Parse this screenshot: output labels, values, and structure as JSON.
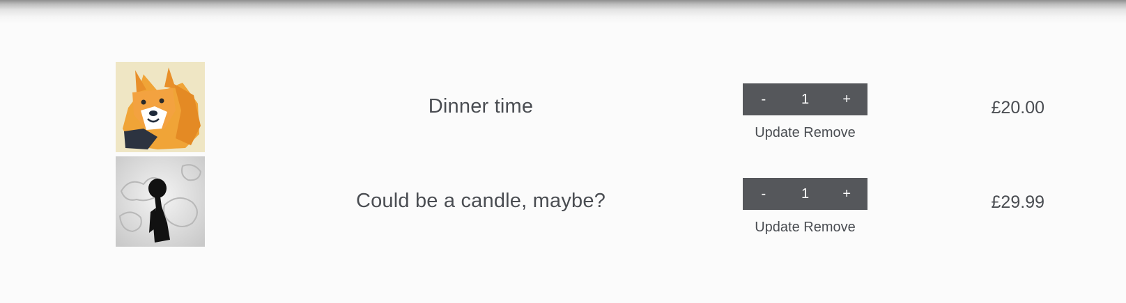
{
  "cart": {
    "items": [
      {
        "image_alt": "fox illustration",
        "title": "Dinner time",
        "quantity": {
          "decrement_label": "-",
          "value": "1",
          "increment_label": "+"
        },
        "update_label": "Update",
        "remove_label": "Remove",
        "price": "£20.00"
      },
      {
        "image_alt": "silhouette figure illustration",
        "title": "Could be a candle, maybe?",
        "quantity": {
          "decrement_label": "-",
          "value": "1",
          "increment_label": "+"
        },
        "update_label": "Update",
        "remove_label": "Remove",
        "price": "£29.99"
      }
    ]
  },
  "colors": {
    "background": "#fbfbfb",
    "text": "#4a4d52",
    "quantity_box": "#55575b",
    "quantity_text": "#ffffff"
  }
}
